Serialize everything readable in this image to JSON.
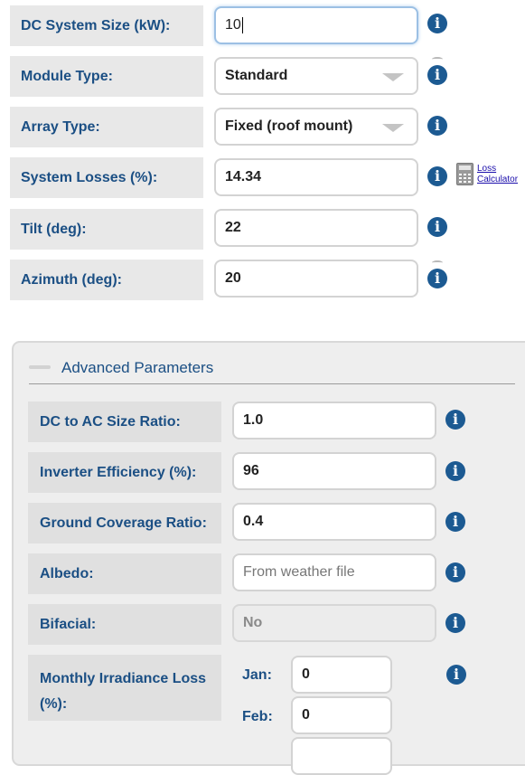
{
  "basic": [
    {
      "label": "DC System Size (kW):",
      "value": "10",
      "kind": "text",
      "focused": true
    },
    {
      "label": "Module Type:",
      "value": "Standard",
      "kind": "select"
    },
    {
      "label": "Array Type:",
      "value": "Fixed (roof mount)",
      "kind": "select"
    },
    {
      "label": "System Losses (%):",
      "value": "14.34",
      "kind": "text"
    },
    {
      "label": "Tilt (deg):",
      "value": "22",
      "kind": "text"
    },
    {
      "label": "Azimuth (deg):",
      "value": "20",
      "kind": "text"
    }
  ],
  "loss_calculator": {
    "line1": "Loss",
    "line2": "Calculator",
    "icon": "calculator-icon"
  },
  "advanced": {
    "title": "Advanced Parameters",
    "rows": [
      {
        "label": "DC to AC Size Ratio:",
        "value": "1.0",
        "kind": "text"
      },
      {
        "label": "Inverter Efficiency (%):",
        "value": "96",
        "kind": "text"
      },
      {
        "label": "Ground Coverage Ratio:",
        "value": "0.4",
        "kind": "text"
      },
      {
        "label": "Albedo:",
        "value": "",
        "placeholder": "From weather file",
        "kind": "text"
      },
      {
        "label": "Bifacial:",
        "value": "No",
        "kind": "disabled-select"
      }
    ],
    "monthly": {
      "label_line1": "Monthly Irradiance Loss",
      "label_line2": "(%):",
      "months": [
        {
          "name": "Jan:",
          "value": "0"
        },
        {
          "name": "Feb:",
          "value": "0"
        }
      ]
    }
  },
  "info_icon": "info-icon",
  "colors": {
    "label_text": "#1b4f84",
    "info_icon": "#1c5a92",
    "label_bg": "#e8e8e8"
  }
}
